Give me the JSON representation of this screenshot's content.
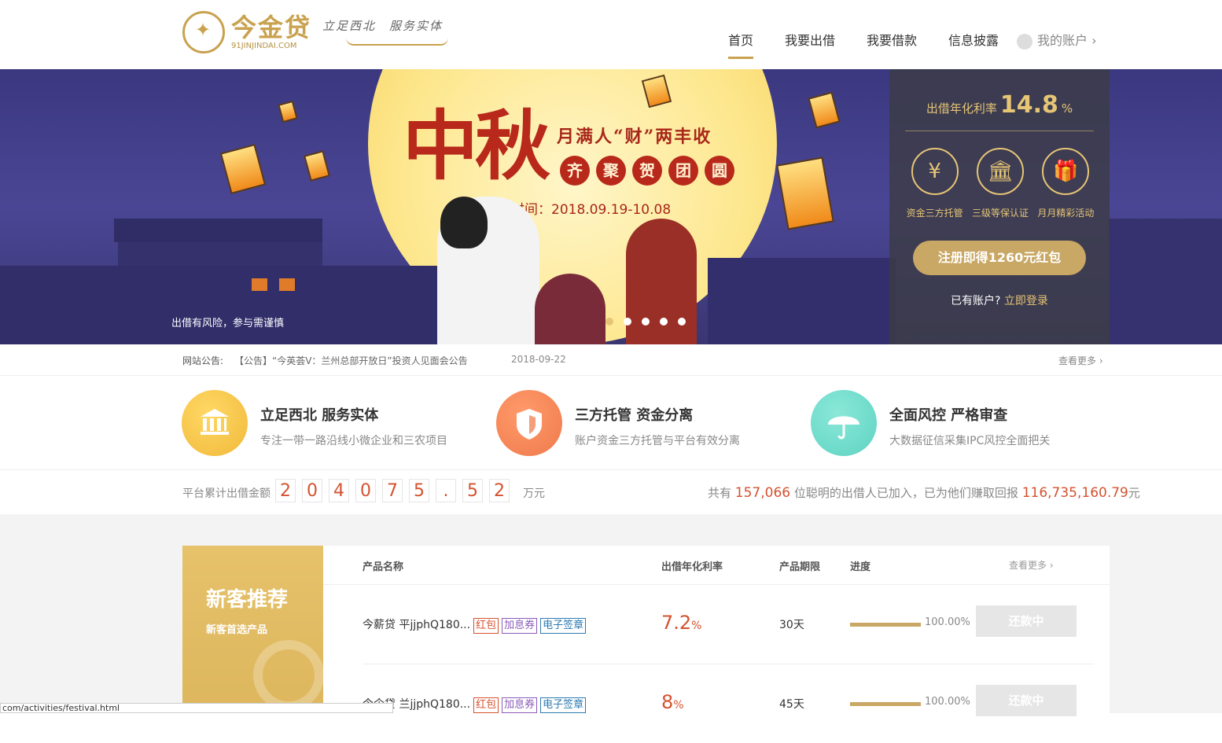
{
  "header": {
    "logo_name": "今金贷",
    "logo_domain": "91JINJINDAI.COM",
    "slogan": "立足西北　服务实体",
    "nav": [
      {
        "label": "首页",
        "active": true
      },
      {
        "label": "我要出借"
      },
      {
        "label": "我要借款"
      },
      {
        "label": "信息披露"
      },
      {
        "label": "我的账户 ›"
      }
    ]
  },
  "banner": {
    "title": "中秋",
    "subtitle": "月满人“财”两丰收",
    "circles": [
      "齐",
      "聚",
      "贺",
      "团",
      "圆"
    ],
    "date_text": "活动时间：2018.09.19-10.08",
    "risk_note": "出借有风险，参与需谨慎",
    "slides": 5,
    "active_slide": 0
  },
  "side_panel": {
    "rate_label": "出借年化利率",
    "rate_value": "14.8",
    "rate_unit": "%",
    "features": [
      {
        "icon": "yen-shield-icon",
        "glyph": "¥",
        "label": "资金三方托管"
      },
      {
        "icon": "bank-icon",
        "glyph": "🏛",
        "label": "三级等保认证"
      },
      {
        "icon": "gift-icon",
        "glyph": "🎁",
        "label": "月月精彩活动"
      }
    ],
    "register_btn": "注册即得1260元红包",
    "login_prefix": "已有账户?",
    "login_link": "立即登录"
  },
  "notice": {
    "label": "网站公告:",
    "text": "【公告】“今英荟V：兰州总部开放日”投资人见面会公告",
    "date": "2018-09-22",
    "more": "查看更多 ›"
  },
  "highlights": [
    {
      "title": "立足西北 服务实体",
      "desc": "专注一带一路沿线小微企业和三农项目",
      "color": "#f0b93a",
      "icon": "bank-icon"
    },
    {
      "title": "三方托管 资金分离",
      "desc": "账户资金三方托管与平台有效分离",
      "color": "#ef7a4c",
      "icon": "shield-icon"
    },
    {
      "title": "全面风控 严格审查",
      "desc": "大数据征信采集IPC风控全面把关",
      "color": "#5fd3c2",
      "icon": "umbrella-icon"
    }
  ],
  "stats": {
    "label": "平台累计出借金额",
    "digits": [
      "2",
      "0",
      "4",
      "0",
      "7",
      "5",
      ".",
      "5",
      "2"
    ],
    "unit": "万元",
    "right_prefix": "共有",
    "investors": "157,066",
    "right_mid": "位聪明的出借人已加入，已为他们赚取回报",
    "earned": "116,735,160.79",
    "right_suffix": "元"
  },
  "promo": {
    "title": "新客推荐",
    "subtitle": "新客首选产品"
  },
  "products": {
    "headers": {
      "name": "产品名称",
      "rate": "出借年化利率",
      "term": "产品期限",
      "progress": "进度",
      "more": "查看更多 ›"
    },
    "rows": [
      {
        "name": "今薪贷 平jjphQ180...",
        "tags": [
          "红包",
          "加息券",
          "电子签章"
        ],
        "rate": "7.2",
        "rate_unit": "%",
        "term": "30天",
        "progress": 1.0,
        "progress_text": "100.00%",
        "status": "还款中"
      },
      {
        "name": "今企贷 兰jjphQ180...",
        "tags": [
          "红包",
          "加息券",
          "电子签章"
        ],
        "rate": "8",
        "rate_unit": "%",
        "term": "45天",
        "progress": 1.0,
        "progress_text": "100.00%",
        "status": "还款中"
      }
    ]
  },
  "status_bar": "com/activities/festival.html"
}
